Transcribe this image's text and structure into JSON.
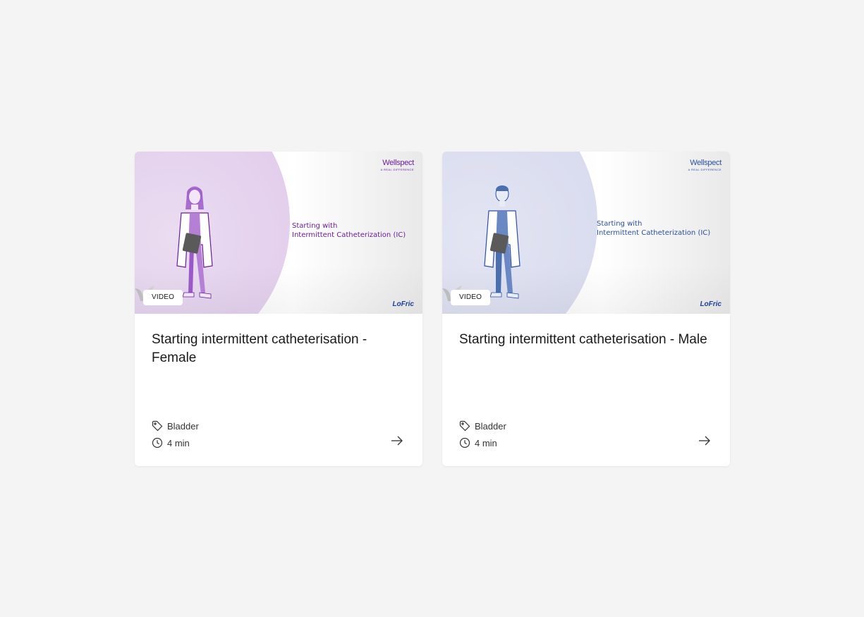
{
  "cards": [
    {
      "badge": "VIDEO",
      "title": "Starting intermittent catheterisation - Female",
      "tag": "Bladder",
      "duration": "4 min",
      "thumb_brand": "Wellspect",
      "thumb_brand_tagline": "A REAL DIFFERENCE",
      "thumb_title_line1": "Starting with",
      "thumb_title_line2": "Intermittent Catheterization (IC)",
      "thumb_logo": "LoFric",
      "accent": "#6a1d9a",
      "halo": "#e6d6ee",
      "figure_color": "#9b59c8"
    },
    {
      "badge": "VIDEO",
      "title": "Starting intermittent catheterisation - Male",
      "tag": "Bladder",
      "duration": "4 min",
      "thumb_brand": "Wellspect",
      "thumb_brand_tagline": "A REAL DIFFERENCE",
      "thumb_title_line1": "Starting with",
      "thumb_title_line2": "Intermittent Catheterization (IC)",
      "thumb_logo": "LoFric",
      "accent": "#2a4f9e",
      "halo": "#dcdff0",
      "figure_color": "#4a6fb0"
    }
  ],
  "icons": {
    "tag": "tag-icon",
    "clock": "clock-icon",
    "arrow": "arrow-right-icon"
  }
}
